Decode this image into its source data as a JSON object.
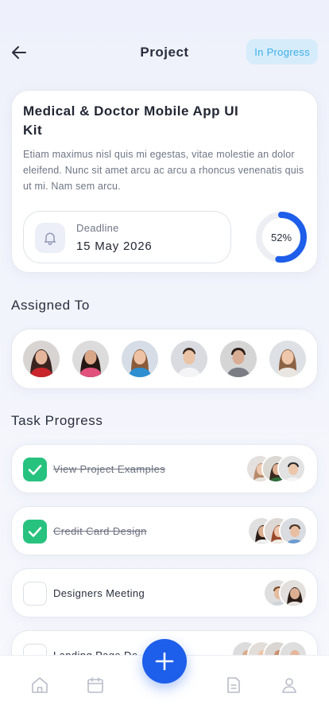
{
  "header": {
    "title": "Project",
    "status": "In Progress"
  },
  "project": {
    "title": "Medical & Doctor Mobile App UI Kit",
    "description": "Etiam maximus nisl quis mi egestas, vitae molestie an dolor eleifend. Nunc sit amet arcu ac arcu a rhoncus venenatis quis ut mi. Nam sem arcu.",
    "deadline_label": "Deadline",
    "deadline_date": "15 May 2026",
    "progress": 52,
    "progress_label": "52%"
  },
  "assigned": {
    "title": "Assigned To"
  },
  "tasks": {
    "title": "Task Progress",
    "items": [
      {
        "label": "View Project Examples",
        "done": true
      },
      {
        "label": "Credit Card Design",
        "done": true
      },
      {
        "label": "Designers Meeting",
        "done": false
      },
      {
        "label": "Landing Page De",
        "done": false
      }
    ]
  },
  "colors": {
    "accent": "#1d5eea",
    "success": "#27c27e",
    "status_bg": "#d7ecfb",
    "status_text": "#3bb0ea"
  },
  "nav": {
    "icons": [
      "home-icon",
      "calendar-icon",
      "add-icon",
      "document-icon",
      "profile-icon"
    ]
  }
}
